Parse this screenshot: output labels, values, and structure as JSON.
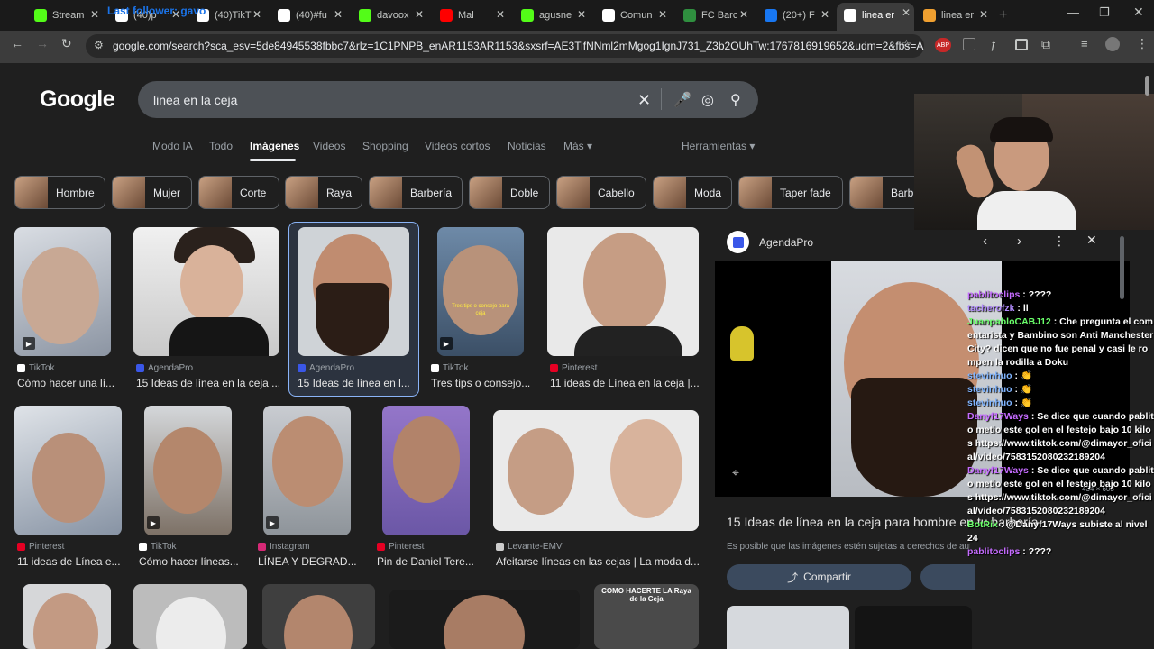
{
  "browser": {
    "tabs": [
      {
        "label": "Stream",
        "icon": "kick-icon",
        "color": "#53fc18"
      },
      {
        "label": "(40)p",
        "icon": "tiktok-icon",
        "color": "#ffffff"
      },
      {
        "label": "(40)TikT",
        "icon": "tiktok-icon",
        "color": "#ffffff"
      },
      {
        "label": "(40)#fu",
        "icon": "tiktok-icon",
        "color": "#ffffff"
      },
      {
        "label": "davoox",
        "icon": "kick-icon",
        "color": "#53fc18"
      },
      {
        "label": "Mal",
        "icon": "youtube-icon",
        "color": "#ff0000"
      },
      {
        "label": "agusne",
        "icon": "kick-icon",
        "color": "#53fc18"
      },
      {
        "label": "Comun",
        "icon": "x-icon",
        "color": "#ffffff"
      },
      {
        "label": "FC Barc",
        "icon": "barca-icon",
        "color": "#2f8f3f"
      },
      {
        "label": "(20+) F",
        "icon": "facebook-icon",
        "color": "#1877f2"
      },
      {
        "label": "linea er",
        "icon": "google-icon",
        "color": "#ffffff"
      },
      {
        "label": "linea er",
        "icon": "agendapro-icon",
        "color": "#f0a030"
      }
    ],
    "overlay_text": "Last follower: gavo",
    "url": "google.com/search?sca_esv=5de84945538fbbc7&rlz=1C1PNPB_enAR1153AR1153&sxsrf=AE3TifNNml2mMgog1IgnJ731_Z3b2OUhTw:1767816919652&udm=2&fbs=AIljpHx..."
  },
  "google": {
    "logo": "Google",
    "query": "linea en la ceja",
    "tabs": [
      "Modo IA",
      "Todo",
      "Imágenes",
      "Videos",
      "Shopping",
      "Videos cortos",
      "Noticias",
      "Más"
    ],
    "tools": "Herramientas",
    "chips": [
      "Hombre",
      "Mujer",
      "Corte",
      "Raya",
      "Barbería",
      "Doble",
      "Cabello",
      "Moda",
      "Taper fade",
      "Barb"
    ]
  },
  "results": [
    {
      "source": "TikTok",
      "title": "Cómo hacer una lí..."
    },
    {
      "source": "AgendaPro",
      "title": "15 Ideas de línea en la ceja ..."
    },
    {
      "source": "AgendaPro",
      "title": "15 Ideas de línea en l..."
    },
    {
      "source": "TikTok",
      "title": "Tres tips o consejo..."
    },
    {
      "source": "Pinterest",
      "title": "11 ideas de Línea en la ceja |..."
    },
    {
      "source": "Pinterest",
      "title": "11 ideas de Línea e..."
    },
    {
      "source": "TikTok",
      "title": "Cómo hacer líneas..."
    },
    {
      "source": "Instagram",
      "title": "LÍNEA Y DEGRAD..."
    },
    {
      "source": "Pinterest",
      "title": "Pin de Daniel Tere..."
    },
    {
      "source": "Levante-EMV",
      "title": "Afeitarse líneas en las cejas | La moda d..."
    }
  ],
  "thumb_caption": "Tres tips o consejo para ceja",
  "thumb_last_caption": "COMO HACERTE LA Raya de la Ceja",
  "preview": {
    "source": "AgendaPro",
    "dims": "434 × 603",
    "title": "15 Ideas de línea en la ceja para hombre en tu barbería",
    "notice": "Es posible que las imágenes estén sujetas a derechos de autor.",
    "share": "Compartir"
  },
  "chat": [
    {
      "user": "pablitoclips",
      "msg": "????",
      "cls": "n4"
    },
    {
      "user": "tacherofzk",
      "msg": "ll",
      "cls": "n1"
    },
    {
      "user": "JuanpabloCABJ12",
      "msg": "Che pregunta el comentarista y Bambino son Anti Manchester City? dicen que no fue penal y casi le rompen la rodilla a Doku",
      "cls": "n2"
    },
    {
      "user": "stevinhuo",
      "msg": "👏",
      "cls": "n3"
    },
    {
      "user": "stevinhuo",
      "msg": "👏",
      "cls": "n3"
    },
    {
      "user": "stevinhuo",
      "msg": "👏",
      "cls": "n3"
    },
    {
      "user": "Danyf17Ways",
      "msg": "Se dice que cuando pablito metio este gol en el festejo bajo 10 kilos https://www.tiktok.com/@dimayor_oficial/video/7583152080232189204",
      "cls": "n4"
    },
    {
      "user": "Danyf17Ways",
      "msg": "Se dice que cuando pablito metio este gol en el festejo bajo 10 kilos https://www.tiktok.com/@dimayor_oficial/video/7583152080232189204",
      "cls": "n4"
    },
    {
      "user": "BotRix",
      "msg": "@Danyf17Ways subiste al nivel 24",
      "cls": "n2"
    },
    {
      "user": "pablitoclips",
      "msg": "????",
      "cls": "n4"
    }
  ]
}
